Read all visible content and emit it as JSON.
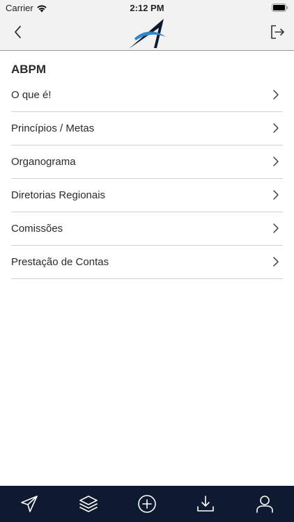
{
  "status_bar": {
    "carrier": "Carrier",
    "time": "2:12 PM"
  },
  "nav_bar": {
    "back_icon": "chevron-left-icon",
    "logo": "abpm-logo",
    "logout_icon": "logout-icon"
  },
  "main": {
    "title": "ABPM",
    "items": [
      {
        "label": "O que é!"
      },
      {
        "label": "Princípios / Metas"
      },
      {
        "label": "Organograma"
      },
      {
        "label": "Diretorias Regionais"
      },
      {
        "label": "Comissões"
      },
      {
        "label": "Prestação de Contas"
      }
    ]
  },
  "tab_bar": {
    "items": [
      {
        "icon": "send-icon"
      },
      {
        "icon": "layers-icon"
      },
      {
        "icon": "add-circle-icon"
      },
      {
        "icon": "download-icon"
      },
      {
        "icon": "profile-icon"
      }
    ]
  },
  "colors": {
    "header_bg": "#f2f2f2",
    "tab_bar_bg": "#0e1a30",
    "divider": "#d0d0d0",
    "logo_dark": "#0e1a30",
    "logo_accent": "#2f86c9"
  }
}
